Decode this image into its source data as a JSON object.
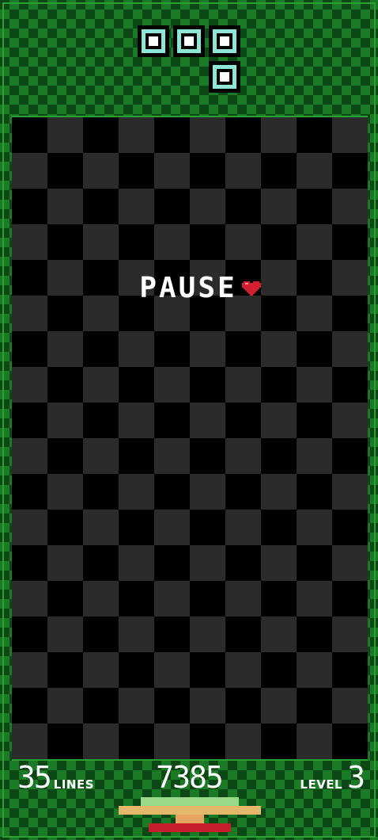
{
  "game": {
    "pause_text": "PAUSE",
    "lines_value": "35",
    "lines_label": "LINES",
    "score_value": "7385",
    "level_label": "LEVEL",
    "level_value": "3"
  },
  "next_piece": {
    "shape": "J",
    "color": "#8ee6d6"
  },
  "colors": {
    "frame_green": "#1a7a26",
    "frame_dark": "#0c4716",
    "board_dark": "#2b2b2b",
    "heart": "#d32030",
    "stack_green": "#9ad88a",
    "stack_tan": "#e3b86a",
    "stack_orange": "#e8a460",
    "stack_red": "#c8202a"
  },
  "icons": {
    "pause_heart": "heart-icon",
    "stack": "stack-icon"
  }
}
